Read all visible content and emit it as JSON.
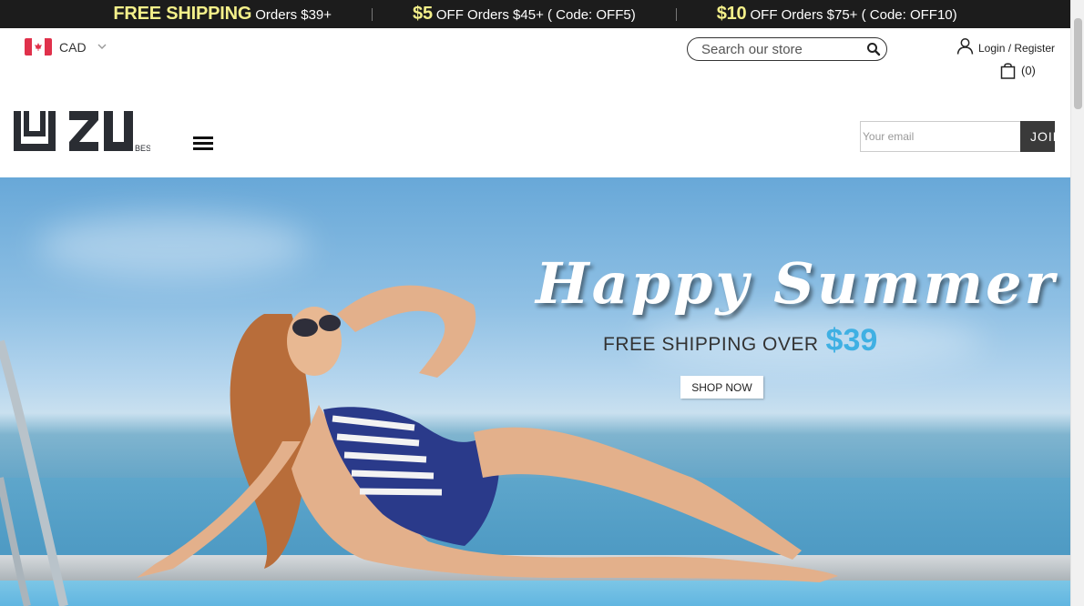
{
  "promo": [
    {
      "big": "FREE SHIPPING",
      "small": "Orders $39+"
    },
    {
      "big": "$5",
      "small": "OFF Orders $45+ ( Code: OFF5)"
    },
    {
      "big": "$10",
      "small": "OFF Orders $75+ ( Code: OFF10)"
    }
  ],
  "header": {
    "currency": "CAD",
    "search_placeholder": "Search our store",
    "account_label": "Login / Register",
    "cart_count": "(0)"
  },
  "newsletter": {
    "placeholder": "Your email",
    "button": "JOIN"
  },
  "hero": {
    "title": "Happy Summer",
    "subtitle": "FREE SHIPPING OVER",
    "price": "$39",
    "cta": "SHOP NOW"
  },
  "logo": {
    "text": "UZU",
    "tag": "BEST"
  },
  "colors": {
    "promo_bg": "#1c1c1c",
    "promo_accent": "#f4f08a",
    "price_blue": "#3fb0e3"
  },
  "icons": [
    "canada-flag-icon",
    "chevron-down-icon",
    "search-icon",
    "user-icon",
    "shopping-bag-icon",
    "menu-icon"
  ]
}
